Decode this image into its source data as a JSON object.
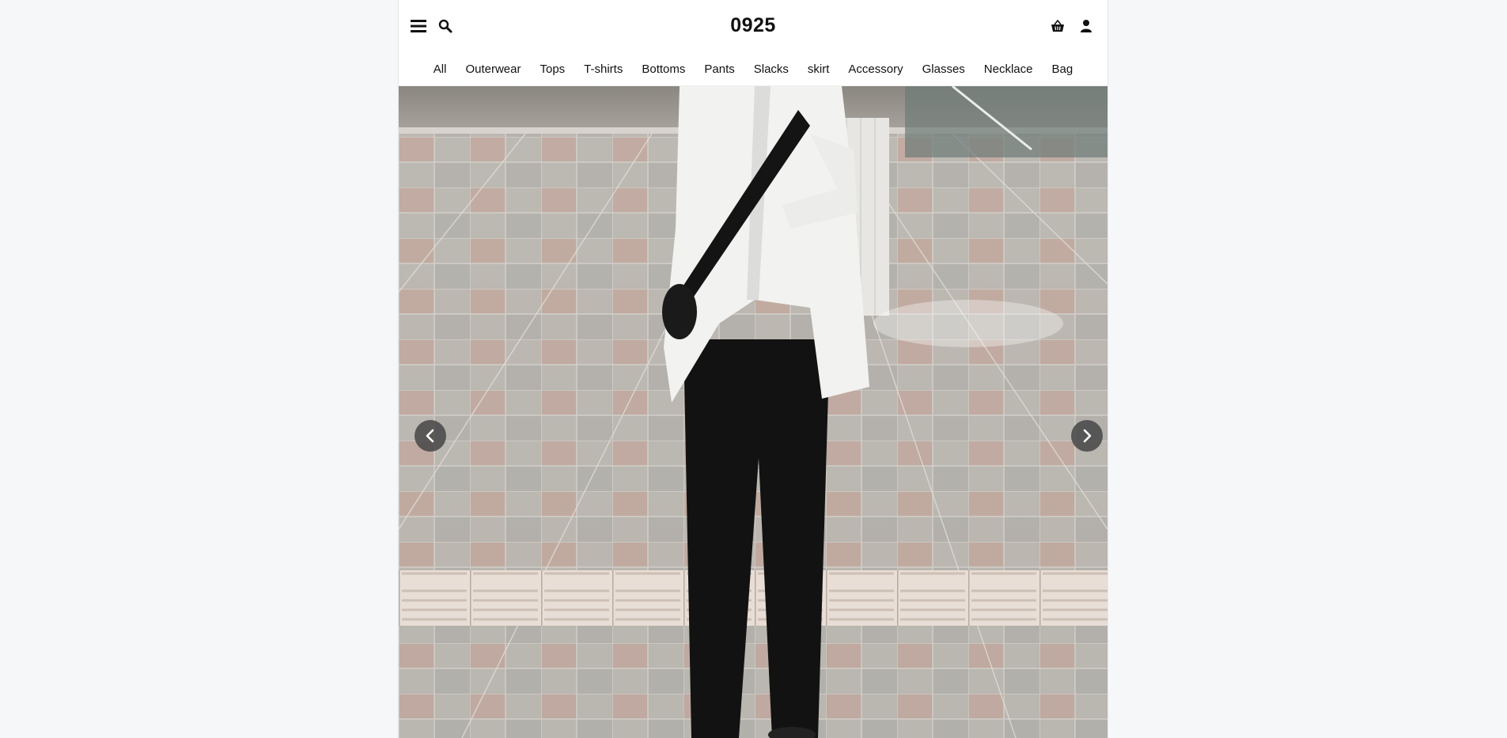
{
  "header": {
    "brand": "0925",
    "icons": {
      "menu": "menu-icon",
      "search": "search-icon",
      "cart": "basket-icon",
      "account": "user-icon"
    }
  },
  "nav": {
    "items": [
      {
        "label": "All"
      },
      {
        "label": "Outerwear"
      },
      {
        "label": "Tops"
      },
      {
        "label": "T-shirts"
      },
      {
        "label": "Bottoms"
      },
      {
        "label": "Pants"
      },
      {
        "label": "Slacks"
      },
      {
        "label": "skirt"
      },
      {
        "label": "Accessory"
      },
      {
        "label": "Glasses"
      },
      {
        "label": "Necklace"
      },
      {
        "label": "Bag"
      }
    ]
  },
  "carousel": {
    "prev_icon": "chevron-left-icon",
    "next_icon": "chevron-right-icon"
  },
  "colors": {
    "page_background": "#f5f7f9",
    "text": "#111111",
    "arrow_background": "#464646"
  }
}
